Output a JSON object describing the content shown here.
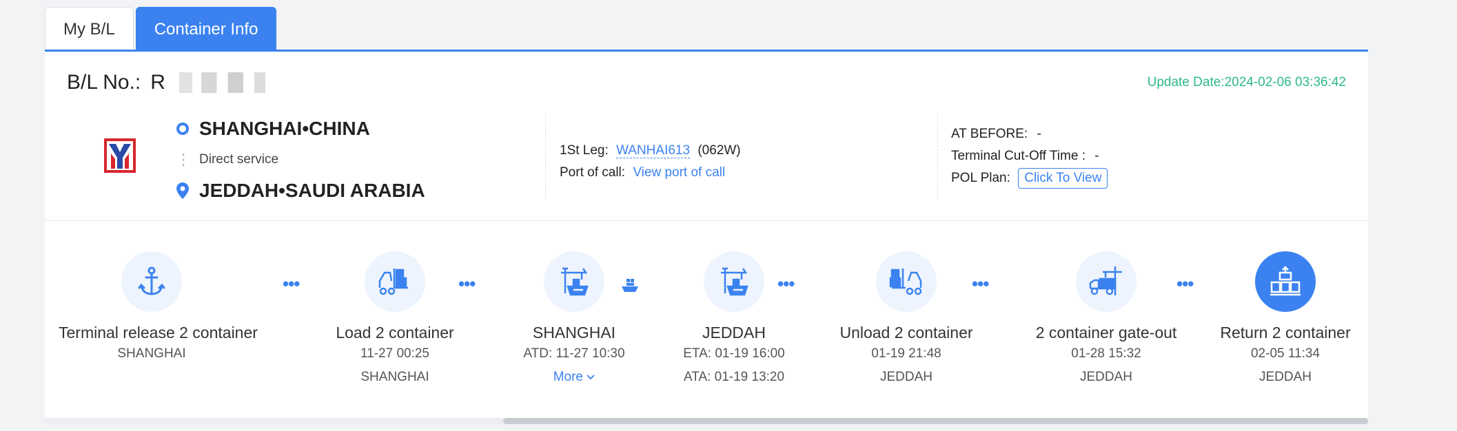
{
  "tabs": [
    {
      "label": "My B/L"
    },
    {
      "label": "Container Info"
    }
  ],
  "bl": {
    "label": "B/L No.:",
    "number_prefix": "R"
  },
  "update_date": "Update Date:2024-02-06 03:36:42",
  "route": {
    "origin": "SHANGHAI•CHINA",
    "service": "Direct service",
    "destination": "JEDDAH•SAUDI ARABIA"
  },
  "leg": {
    "label": "1St Leg:",
    "vessel": "WANHAI613",
    "voyage": "(062W)",
    "port_of_call_label": "Port of call:",
    "port_of_call_link": "View port of call"
  },
  "cutoff": {
    "at_before_label": "AT BEFORE:",
    "at_before_value": "-",
    "terminal_label": "Terminal Cut-Off Time :",
    "terminal_value": "-",
    "pol_label": "POL Plan:",
    "pol_button": "Click To View"
  },
  "steps": [
    {
      "title": "Terminal release 2 container",
      "line1": "SHANGHAI",
      "icon": "anchor-icon"
    },
    {
      "title": "Load 2 container",
      "line1": "11-27 00:25",
      "line2": "SHANGHAI",
      "icon": "forklift-icon"
    },
    {
      "title": "SHANGHAI",
      "line1": "ATD: 11-27 10:30",
      "more": "More",
      "icon": "port-crane-ship-icon"
    },
    {
      "title": "JEDDAH",
      "line1": "ETA: 01-19 16:00",
      "line2": "ATA: 01-19 13:20",
      "icon": "port-crane-ship-icon"
    },
    {
      "title": "Unload 2 container",
      "line1": "01-19 21:48",
      "line2": "JEDDAH",
      "icon": "forklift-icon"
    },
    {
      "title": "2 container gate-out",
      "line1": "01-28 15:32",
      "line2": "JEDDAH",
      "icon": "truck-crane-icon"
    },
    {
      "title": "Return 2 container",
      "line1": "02-05 11:34",
      "line2": "JEDDAH",
      "icon": "container-stack-icon"
    }
  ],
  "colors": {
    "accent": "#3b82f0",
    "update": "#2db888",
    "logo_red": "#d7262d"
  }
}
